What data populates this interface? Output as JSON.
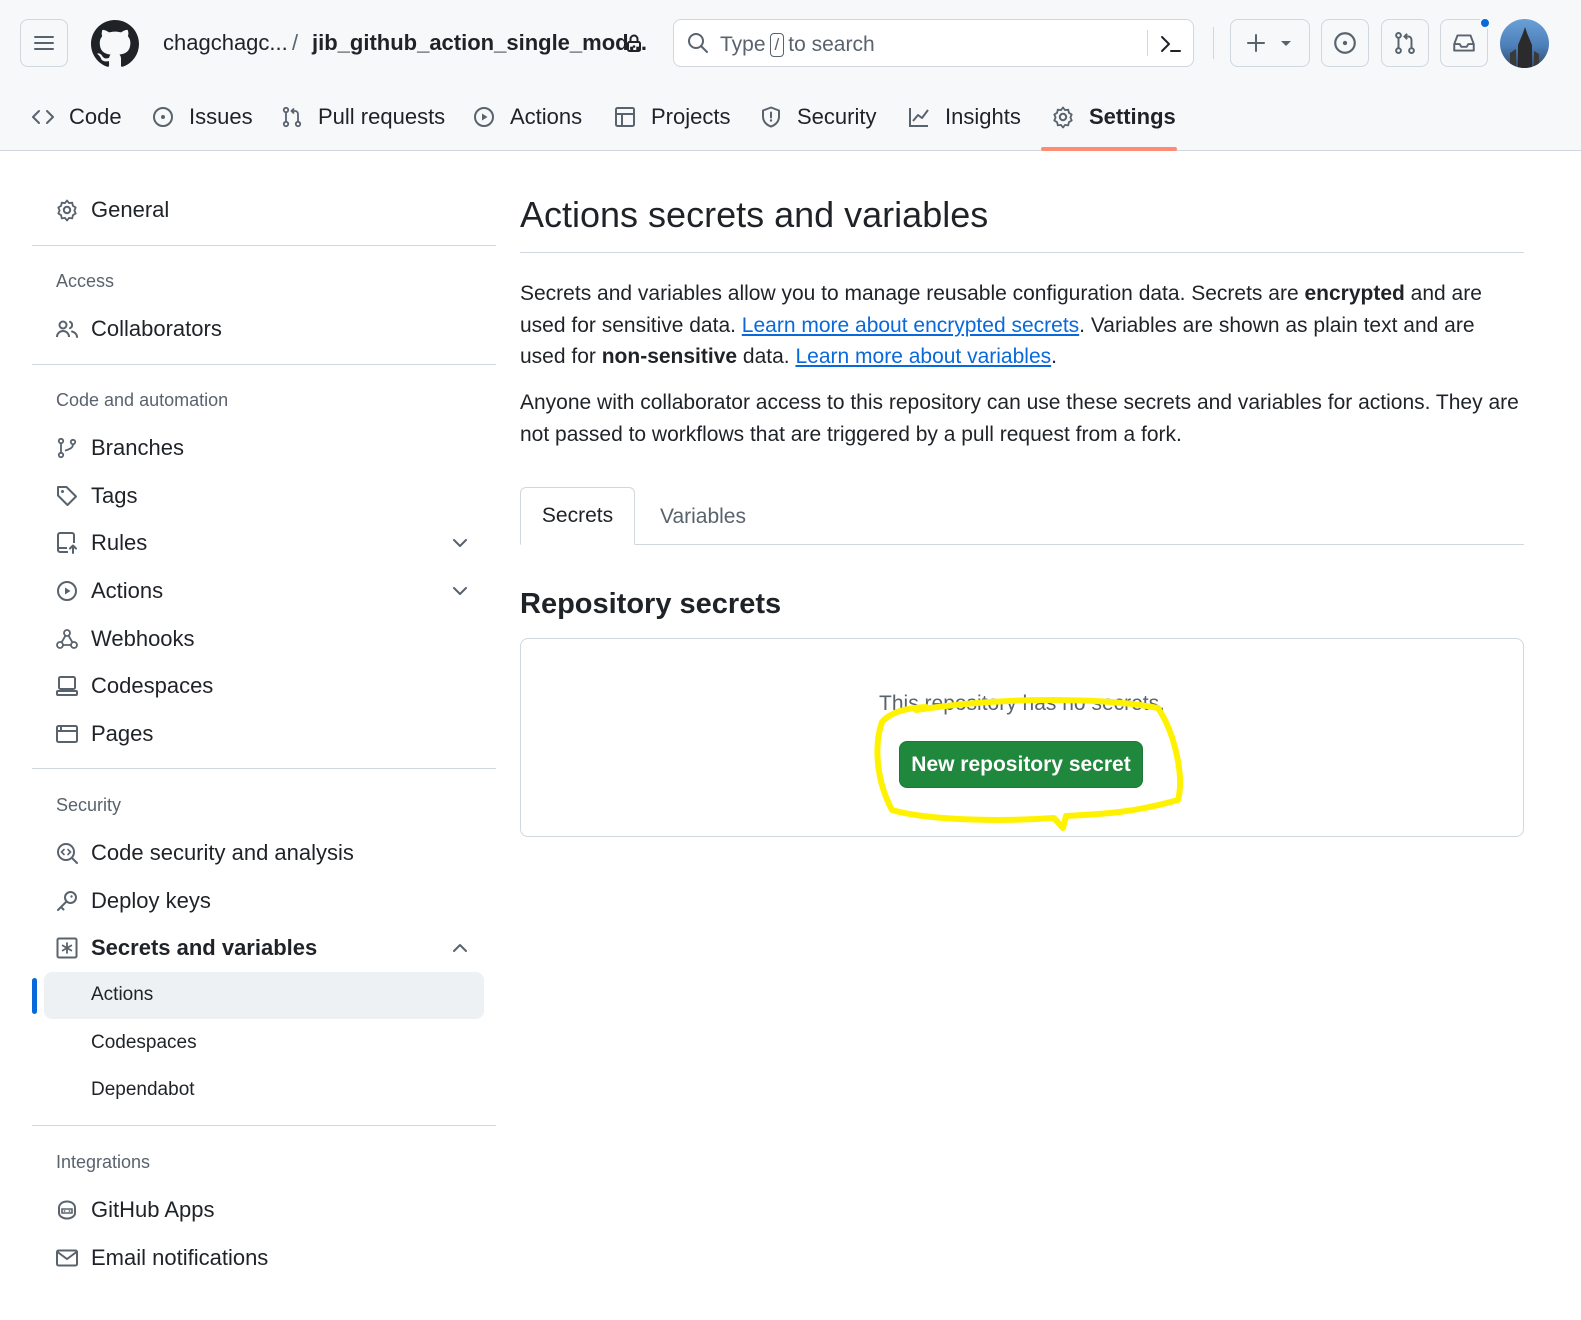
{
  "header": {
    "owner": "chagchagc...",
    "separator": "/",
    "repo": "jib_github_action_single_mod...",
    "search": {
      "prefix": "Type",
      "key": "/",
      "suffix": "to search"
    }
  },
  "repo_tabs": [
    {
      "label": "Code"
    },
    {
      "label": "Issues"
    },
    {
      "label": "Pull requests"
    },
    {
      "label": "Actions"
    },
    {
      "label": "Projects"
    },
    {
      "label": "Security"
    },
    {
      "label": "Insights"
    },
    {
      "label": "Settings",
      "selected": true
    }
  ],
  "sidebar": {
    "general": "General",
    "access_heading": "Access",
    "collaborators": "Collaborators",
    "code_heading": "Code and automation",
    "branches": "Branches",
    "tags": "Tags",
    "rules": "Rules",
    "actions": "Actions",
    "webhooks": "Webhooks",
    "codespaces": "Codespaces",
    "pages": "Pages",
    "security_heading": "Security",
    "code_security": "Code security and analysis",
    "deploy_keys": "Deploy keys",
    "secrets_vars": "Secrets and variables",
    "sub_actions": "Actions",
    "sub_codespaces": "Codespaces",
    "sub_dependabot": "Dependabot",
    "integrations_heading": "Integrations",
    "github_apps": "GitHub Apps",
    "email_notifications": "Email notifications"
  },
  "main": {
    "title": "Actions secrets and variables",
    "p1": {
      "t1": "Secrets and variables allow you to manage reusable configuration data. Secrets are ",
      "b1": "encrypted",
      "t2": " and are used for sensitive data. ",
      "link1": "Learn more about encrypted secrets",
      "t3": ". Variables are shown as plain text and are used for ",
      "b2": "non-sensitive",
      "t4": " data. ",
      "link2": "Learn more about variables",
      "t5": "."
    },
    "p2": "Anyone with collaborator access to this repository can use these secrets and variables for actions. They are not passed to workflows that are triggered by a pull request from a fork.",
    "tab_secrets": "Secrets",
    "tab_variables": "Variables",
    "section_title": "Repository secrets",
    "empty_text": "This repository has no secrets.",
    "new_button": "New repository secret"
  },
  "colors": {
    "accent_blue": "#0969da",
    "primary_green": "#1f883d",
    "tab_underline": "#fd8c73",
    "highlight_yellow": "#fff200"
  }
}
